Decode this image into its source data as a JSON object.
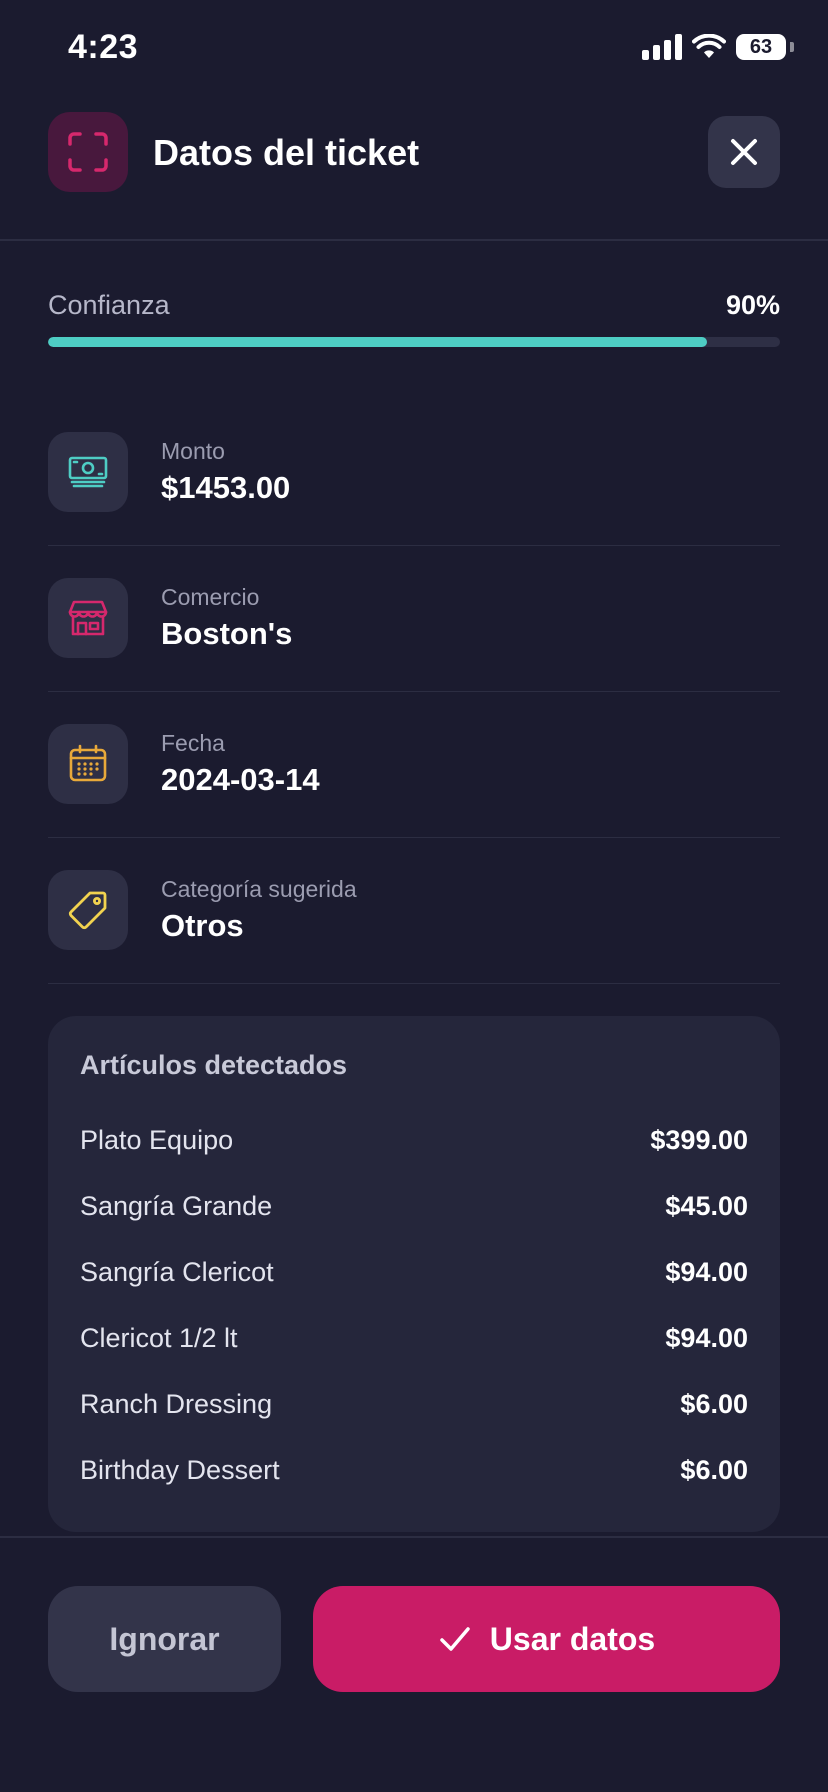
{
  "status_bar": {
    "time": "4:23",
    "battery": "63"
  },
  "header": {
    "title": "Datos del ticket",
    "icon": "scan-icon",
    "close_icon": "close-icon"
  },
  "confidence": {
    "label": "Confianza",
    "value_text": "90%",
    "value": 0.9,
    "color": "#4ecdc4"
  },
  "fields": [
    {
      "label": "Monto",
      "value": "$1453.00",
      "icon": "money-icon",
      "icon_color": "#4ecdc4"
    },
    {
      "label": "Comercio",
      "value": "Boston's",
      "icon": "store-icon",
      "icon_color": "#d6286d"
    },
    {
      "label": "Fecha",
      "value": "2024-03-14",
      "icon": "calendar-icon",
      "icon_color": "#e8a93a"
    },
    {
      "label": "Categoría sugerida",
      "value": "Otros",
      "icon": "tag-icon",
      "icon_color": "#f2d34f"
    }
  ],
  "items": {
    "title": "Artículos detectados",
    "rows": [
      {
        "name": "Plato Equipo",
        "price": "$399.00"
      },
      {
        "name": "Sangría Grande",
        "price": "$45.00"
      },
      {
        "name": "Sangría Clericot",
        "price": "$94.00"
      },
      {
        "name": "Clericot 1/2 lt",
        "price": "$94.00"
      },
      {
        "name": "Ranch Dressing",
        "price": "$6.00"
      },
      {
        "name": "Birthday Dessert",
        "price": "$6.00"
      }
    ]
  },
  "actions": {
    "ignore_label": "Ignorar",
    "use_label": "Usar datos",
    "use_color": "#c91c66"
  }
}
